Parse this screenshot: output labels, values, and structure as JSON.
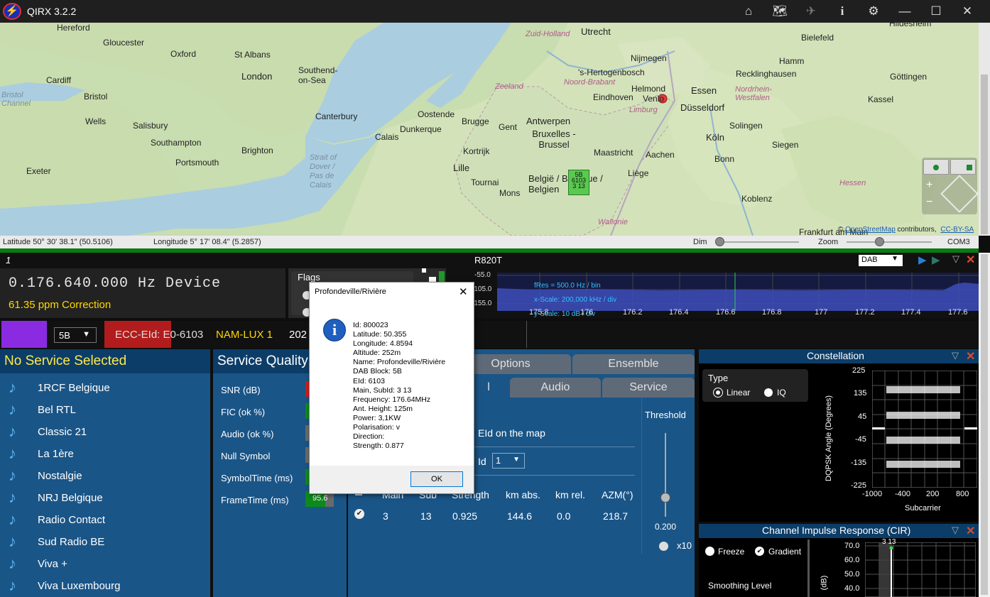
{
  "app": {
    "title": "QIRX 3.2.2"
  },
  "titlebar": {
    "icons": [
      "home-icon",
      "map-book-icon",
      "satellite-icon",
      "info-icon",
      "gear-icon",
      "minimize-icon",
      "maximize-icon",
      "close-icon"
    ]
  },
  "map": {
    "cities": [
      "Hereford",
      "Gloucester",
      "Oxford",
      "St Albans",
      "Cardiff",
      "Bristol",
      "London",
      "Southend-on-Sea",
      "Wells",
      "Salisbury",
      "Southampton",
      "Portsmouth",
      "Brighton",
      "Exeter",
      "Canterbury",
      "Calais",
      "Dunkerque",
      "Oostende",
      "Brugge",
      "Gent",
      "Antwerpen",
      "Bruxelles - Brussel",
      "Lille",
      "Kortrijk",
      "Tournai",
      "Mons",
      "België / Belgique / Belgien",
      "Maastricht",
      "Aachen",
      "Liège",
      "Utrecht",
      "Nijmegen",
      "'s-Hertogenbosch",
      "Eindhoven",
      "Helmond",
      "Venlo",
      "Essen",
      "Düsseldorf",
      "Köln",
      "Solingen",
      "Bonn",
      "Siegen",
      "Koblenz",
      "Bielefeld",
      "Hamm",
      "Göttingen",
      "Kassel",
      "Hildesheim",
      "Frankfurt am Main",
      "Recklinghausen",
      "Zeeland",
      "Noord-Brabant",
      "Limburg",
      "Nordrhein-Westfalen",
      "Hessen",
      "Wallonie",
      "Zuid-Holland",
      "Strait of Dover / Pas de Calais",
      "Bristol Channel"
    ],
    "marker": {
      "block": "5B",
      "eid": "6103",
      "sub": "3 13"
    },
    "attribution_prefix": "©",
    "attribution_link": "OpenStreetMap",
    "attribution_mid": "contributors,",
    "attribution_license": "CC-BY-SA"
  },
  "statusbar": {
    "latitude": "Latitude  50° 30' 38.1\" (50.5106)",
    "longitude": "Longitude  5° 17' 08.4\" (5.2857)",
    "dim": "Dim",
    "zoom": "Zoom",
    "port": "COM3"
  },
  "device": {
    "index": "1",
    "name": "R820T",
    "mode": "DAB",
    "frequency": "0.176.640.000 Hz Device",
    "correction": "61.35 ppm Correction",
    "flags_label": "Flags"
  },
  "spectrum": {
    "db_ticks": [
      "-55.0",
      "-105.0",
      "-155.0"
    ],
    "fres": "fRes = 500.0 Hz / bin",
    "xscale": "x-Scale: 200,000 kHz / div",
    "yscale": "y-Scale: 10 dB / div",
    "freq_ticks": [
      "175.8",
      "176",
      "176.2",
      "176.4",
      "176.6",
      "176.8",
      "177",
      "177.2",
      "177.4",
      "177.6"
    ]
  },
  "ensemble": {
    "block": "5B",
    "ecc_eid": "ECC-EId: E0-6103",
    "name": "NAM-LUX 1",
    "date": "202"
  },
  "services": {
    "header": "No Service Selected",
    "items": [
      "1RCF Belgique",
      "Bel RTL",
      "Classic 21",
      "La 1ère",
      "Nostalgie",
      "NRJ Belgique",
      "Radio Contact",
      "Sud Radio BE",
      "Viva +",
      "Viva Luxembourg"
    ]
  },
  "quality": {
    "header": "Service Quality",
    "rows": [
      {
        "label": "SNR (dB)",
        "color": "#c81e1e"
      },
      {
        "label": "FIC (ok %)",
        "color": "#0d8a1c"
      },
      {
        "label": "Audio (ok %)",
        "color": "#6a6a6a"
      },
      {
        "label": "Null Symbol",
        "color": "#6a6a6a"
      },
      {
        "label": "SymbolTime (ms)",
        "color": "#0d8a1c"
      },
      {
        "label": "FrameTime (ms)",
        "color": "#0d8a1c",
        "value": "95.6"
      }
    ]
  },
  "tabs": {
    "row1": [
      "Options",
      "Ensemble"
    ],
    "row2": [
      "l",
      "Audio",
      "Service"
    ],
    "eid_on_map": "EId on the map",
    "id_label": "Id",
    "id_value": "1",
    "threshold": "Threshold",
    "threshold_value": "0.200",
    "x10": "x10"
  },
  "tx_table": {
    "headers": [
      "Main",
      "Sub",
      "Strength",
      "km abs.",
      "km rel.",
      "AZM(°)"
    ],
    "row": [
      "3",
      "13",
      "0.925",
      "144.6",
      "0.0",
      "218.7"
    ]
  },
  "constellation": {
    "title": "Constellation",
    "type_label": "Type",
    "linear": "Linear",
    "iq": "IQ",
    "ylabel": "DQPSK Angle (Degrees)",
    "xlabel": "Subcarrier",
    "yticks": [
      "225",
      "135",
      "45",
      "-45",
      "-135",
      "-225"
    ],
    "xticks": [
      "-1000",
      "-400",
      "200",
      "800"
    ]
  },
  "cir": {
    "title": "Channel Impulse Response (CIR)",
    "freeze": "Freeze",
    "gradient": "Gradient",
    "smoothing": "Smoothing Level",
    "yticks": [
      "70.0",
      "60.0",
      "50.0",
      "40.0"
    ],
    "ylabel": "(dB)",
    "peak_label": "3 13"
  },
  "dialog": {
    "title": "Profondeville/Rivière",
    "lines": [
      "Id: 800023",
      "Latitude: 50.355",
      "Longitude: 4.8594",
      "Altitude: 252m",
      "Name: Profondeville/Rivière",
      "DAB Block: 5B",
      "EId: 6103",
      "Main, SubId: 3 13",
      "Frequency: 176.64MHz",
      "Ant. Height: 125m",
      "Power: 3,1KW",
      "Polarisation: v",
      "Direction:",
      "Strength: 0.877"
    ],
    "ok": "OK"
  }
}
